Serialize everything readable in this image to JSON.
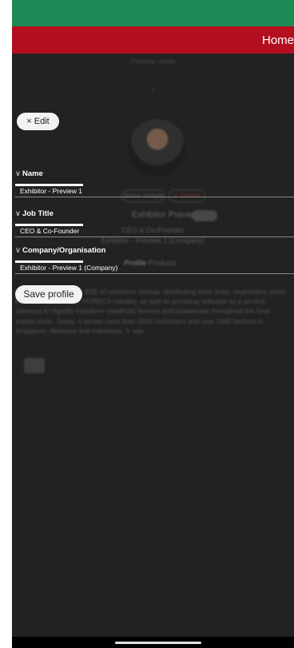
{
  "header": {
    "title": "Home"
  },
  "background": {
    "preview_mode": "Preview mode",
    "chevron": "⌄",
    "pill_a": "Show image",
    "pill_b": "✕ Delete",
    "exhibitor_name": "Exhibitor Preview 1",
    "role": "CEO & Co-Founder",
    "company": "Exhibitor - Preview 1 (Company)",
    "tab_profile": "Profile",
    "tab_products": "Products",
    "description": "Glife Technologies is a B2B eCommerce startup, distributing fresh fruits, vegetables, plant-based products to the HORECA industry, as well as providing software as a service solutions to digitally transform smallhold farmers and businesses throughout the food supply chain. Today, it serves more than 2500 customers and over 1000 farmers in Singapore, Malaysia and Indonesia.",
    "see_more": "✎ see"
  },
  "form": {
    "edit_label": "× Edit",
    "chevron": "∨",
    "name_label": "Name",
    "name_value": "Exhibitor - Preview 1",
    "job_label": "Job Title",
    "job_value": "CEO & Co-Founder",
    "company_label": "Company/Organisation",
    "company_value": "Exhibitor - Preview 1 (Company)",
    "save_label": "Save profile"
  }
}
